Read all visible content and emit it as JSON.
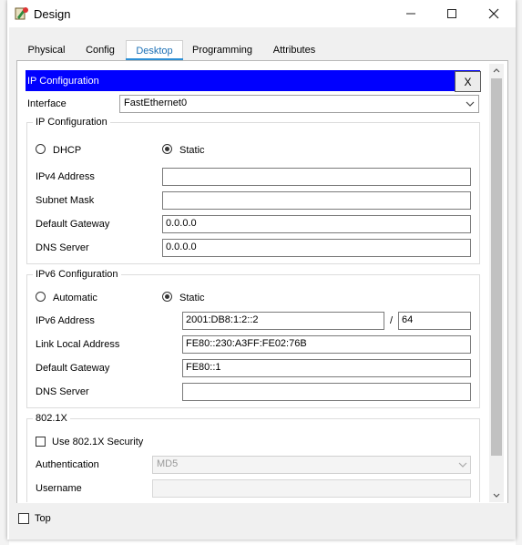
{
  "window": {
    "title": "Design"
  },
  "tabs": [
    "Physical",
    "Config",
    "Desktop",
    "Programming",
    "Attributes"
  ],
  "panel": {
    "title": "IP Configuration",
    "close_label": "X"
  },
  "interface": {
    "label": "Interface",
    "value": "FastEthernet0"
  },
  "ipv4": {
    "legend": "IP Configuration",
    "dhcp_label": "DHCP",
    "static_label": "Static",
    "mode": "Static",
    "fields": [
      {
        "label": "IPv4 Address",
        "value": ""
      },
      {
        "label": "Subnet Mask",
        "value": ""
      },
      {
        "label": "Default Gateway",
        "value": "0.0.0.0"
      },
      {
        "label": "DNS Server",
        "value": "0.0.0.0"
      }
    ]
  },
  "ipv6": {
    "legend": "IPv6 Configuration",
    "auto_label": "Automatic",
    "static_label": "Static",
    "mode": "Static",
    "address_label": "IPv6 Address",
    "address_value": "2001:DB8:1:2::2",
    "prefix_sep": "/",
    "prefix_value": "64",
    "link_local_label": "Link Local Address",
    "link_local_value": "FE80::230:A3FF:FE02:76B",
    "gateway_label": "Default Gateway",
    "gateway_value": "FE80::1",
    "dns_label": "DNS Server",
    "dns_value": ""
  },
  "dot1x": {
    "legend": "802.1X",
    "use_label": "Use 802.1X Security",
    "auth_label": "Authentication",
    "auth_value": "MD5",
    "username_label": "Username"
  },
  "footer": {
    "top_label": "Top"
  },
  "colors": {
    "accent": "#0000ff",
    "tab_active": "#1a6fb5"
  }
}
